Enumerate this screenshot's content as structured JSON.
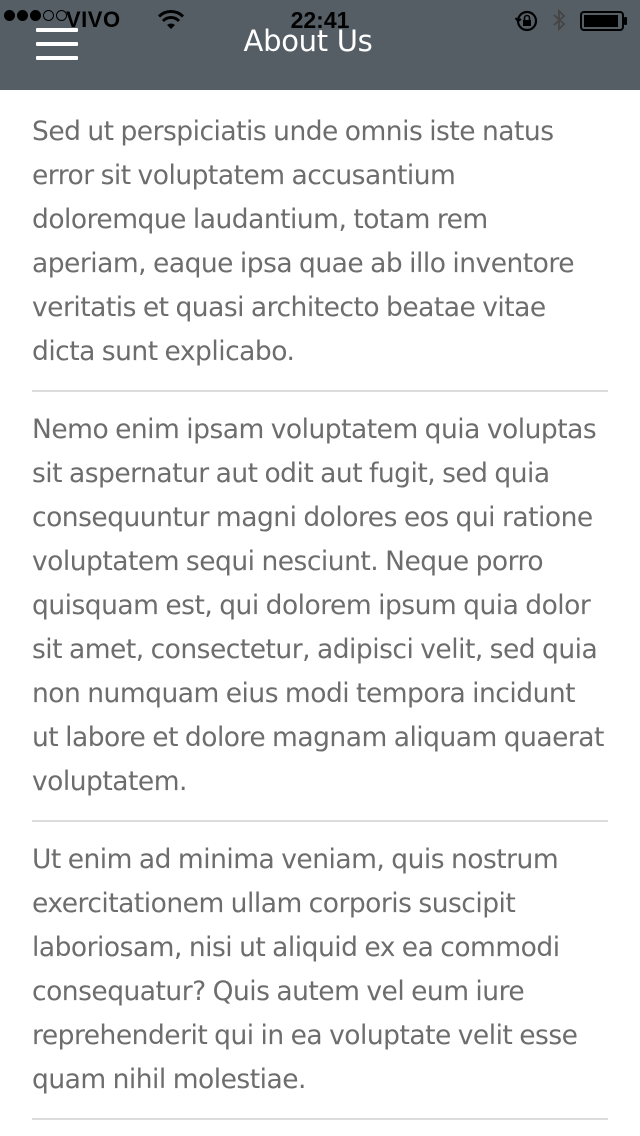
{
  "status_bar": {
    "carrier": "VIVO",
    "time": "22:41",
    "signal_bars_filled": 3,
    "signal_bars_total": 5
  },
  "header": {
    "title": "About Us",
    "background_color": "#555e65",
    "menu_icon": "hamburger-menu-icon"
  },
  "content": {
    "paragraphs": [
      "Sed ut perspiciatis unde omnis iste natus error sit voluptatem accusantium doloremque laudantium, totam rem aperiam, eaque ipsa quae ab illo inventore veritatis et quasi architecto beatae vitae dicta sunt explicabo.",
      "Nemo enim ipsam voluptatem quia voluptas sit aspernatur aut odit aut fugit, sed quia consequuntur magni dolores eos qui ratione voluptatem sequi nesciunt. Neque porro quisquam est, qui dolorem ipsum quia dolor sit amet, consectetur, adipisci velit, sed quia non numquam eius modi tempora incidunt ut labore et dolore magnam aliquam quaerat voluptatem.",
      "Ut enim ad minima veniam, quis nostrum exercitationem ullam corporis suscipit laboriosam, nisi ut aliquid ex ea commodi consequatur? Quis autem vel eum iure reprehenderit qui in ea voluptate velit esse quam nihil molestiae."
    ]
  }
}
